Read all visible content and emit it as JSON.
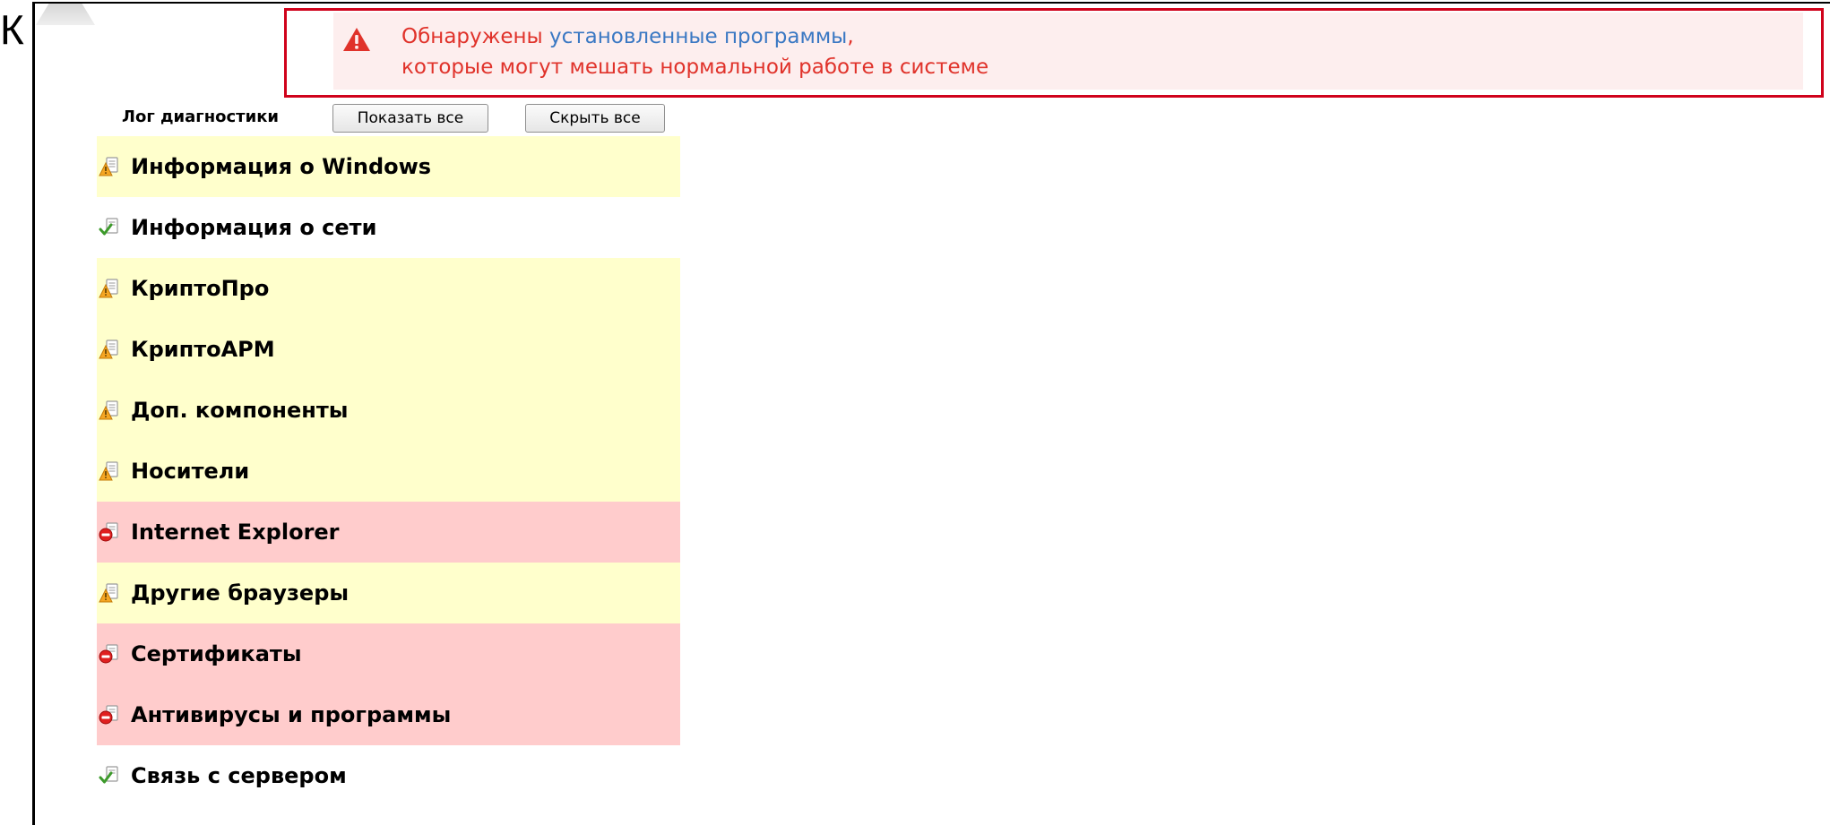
{
  "stray_char": "К",
  "alert": {
    "prefix": "Обнаружены ",
    "link": "установленные программы",
    "suffix": ",",
    "line2": "которые могут мешать нормальной работе в системе",
    "icon": "warning-triangle-icon",
    "colors": {
      "text": "#e0322a",
      "link": "#3a78c3",
      "border": "#d0021b",
      "background": "#fdeeee"
    }
  },
  "toolbar": {
    "label": "Лог диагностики",
    "show_all": "Показать все",
    "hide_all": "Скрыть все"
  },
  "status_colors": {
    "warn": "#ffffcc",
    "error": "#ffcccc",
    "ok": "#ffffff"
  },
  "sections": [
    {
      "label": "Информация о Windows",
      "status": "warn",
      "icon": "warning-document-icon"
    },
    {
      "label": "Информация о сети",
      "status": "ok",
      "icon": "check-document-icon"
    },
    {
      "label": "КриптоПро",
      "status": "warn",
      "icon": "warning-document-icon"
    },
    {
      "label": "КриптоАРМ",
      "status": "warn",
      "icon": "warning-document-icon"
    },
    {
      "label": "Доп. компоненты",
      "status": "warn",
      "icon": "warning-document-icon"
    },
    {
      "label": "Носители",
      "status": "warn",
      "icon": "warning-document-icon"
    },
    {
      "label": "Internet Explorer",
      "status": "error",
      "icon": "error-document-icon"
    },
    {
      "label": "Другие браузеры",
      "status": "warn",
      "icon": "warning-document-icon"
    },
    {
      "label": "Сертификаты",
      "status": "error",
      "icon": "error-document-icon"
    },
    {
      "label": "Антивирусы и программы",
      "status": "error",
      "icon": "error-document-icon"
    },
    {
      "label": "Связь с сервером",
      "status": "ok",
      "icon": "check-document-icon"
    }
  ]
}
